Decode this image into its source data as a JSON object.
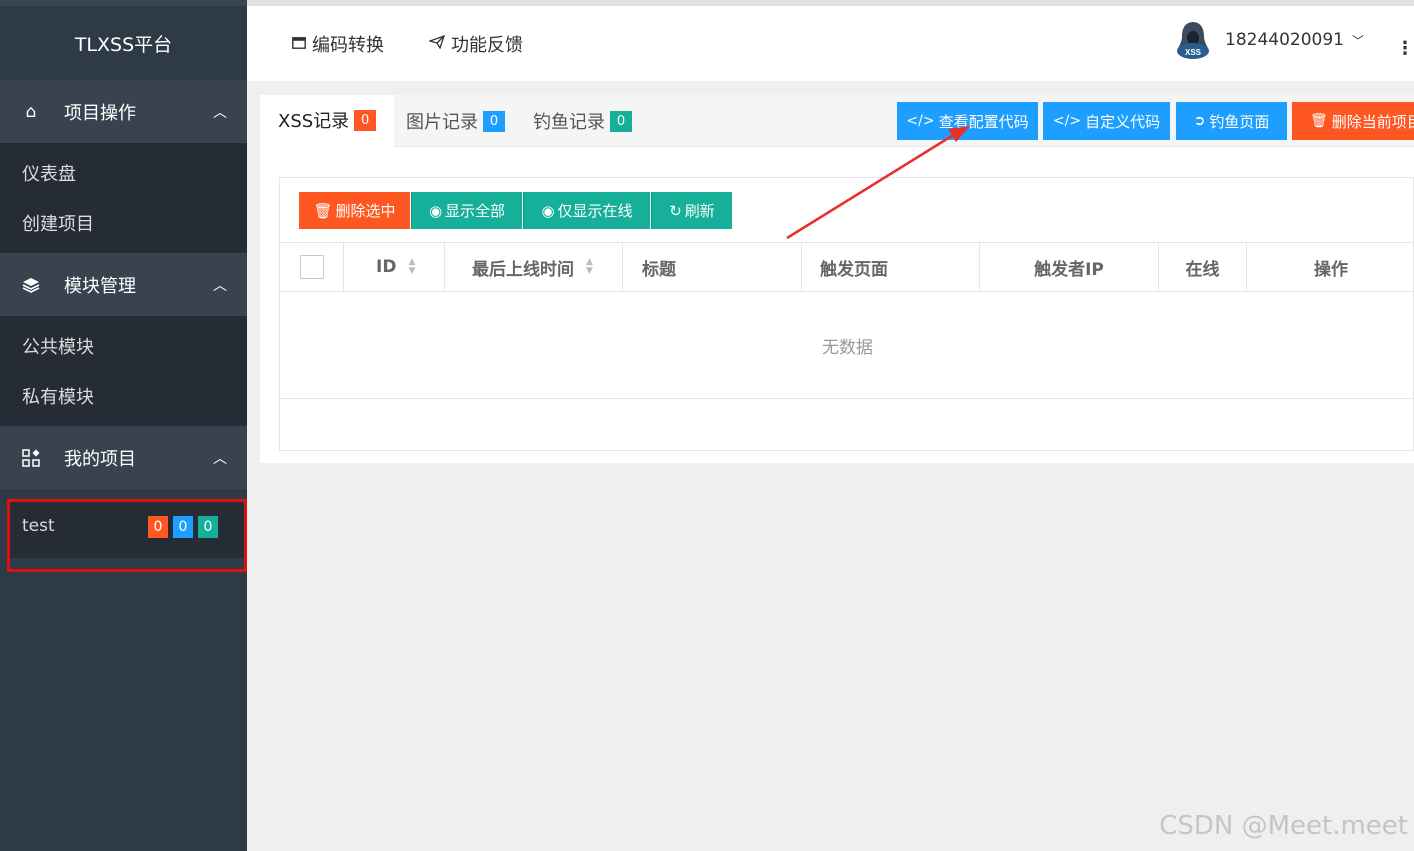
{
  "app": {
    "title": "TLXSS平台"
  },
  "sidebar": {
    "groups": [
      {
        "label": "项目操作",
        "icon": "home-icon",
        "items": [
          "仪表盘",
          "创建项目"
        ]
      },
      {
        "label": "模块管理",
        "icon": "layers-icon",
        "items": [
          "公共模块",
          "私有模块"
        ]
      },
      {
        "label": "我的项目",
        "icon": "apps-icon",
        "items": []
      }
    ],
    "project": {
      "name": "test",
      "counts": [
        "0",
        "0",
        "0"
      ]
    }
  },
  "header": {
    "links": [
      {
        "label": "编码转换",
        "icon": "window-icon"
      },
      {
        "label": "功能反馈",
        "icon": "send-icon"
      }
    ],
    "user": {
      "name": "18244020091",
      "avatar_text": "XSS"
    },
    "more_glyph": "⋮"
  },
  "tabs": [
    {
      "label": "XSS记录",
      "count": "0",
      "color": "#ff5722"
    },
    {
      "label": "图片记录",
      "count": "0",
      "color": "#1e9fff"
    },
    {
      "label": "钓鱼记录",
      "count": "0",
      "color": "#16b09a"
    }
  ],
  "top_buttons": [
    {
      "label": "查看配置代码",
      "icon": "code-icon",
      "glyph": "</>",
      "color": "#1e9fff"
    },
    {
      "label": "自定义代码",
      "icon": "code-icon",
      "glyph": "</>",
      "color": "#1e9fff"
    },
    {
      "label": "钓鱼页面",
      "icon": "fish-icon",
      "glyph": "➲",
      "color": "#1e9fff"
    },
    {
      "label": "删除当前项目",
      "icon": "trash-icon",
      "glyph": "🗑",
      "color": "#ff5722"
    }
  ],
  "toolbar": [
    {
      "label": "删除选中",
      "icon": "trash-icon",
      "glyph": "🗑",
      "color": "#ff5722"
    },
    {
      "label": "显示全部",
      "icon": "eye-icon",
      "glyph": "◉",
      "color": "#16b09a"
    },
    {
      "label": "仅显示在线",
      "icon": "eye-icon",
      "glyph": "◉",
      "color": "#16b09a"
    },
    {
      "label": "刷新",
      "icon": "refresh-icon",
      "glyph": "↻",
      "color": "#16b09a"
    }
  ],
  "table": {
    "columns": [
      "ID",
      "最后上线时间",
      "标题",
      "触发页面",
      "触发者IP",
      "在线",
      "操作"
    ],
    "empty_text": "无数据"
  },
  "watermark": "CSDN @Meet.meet"
}
